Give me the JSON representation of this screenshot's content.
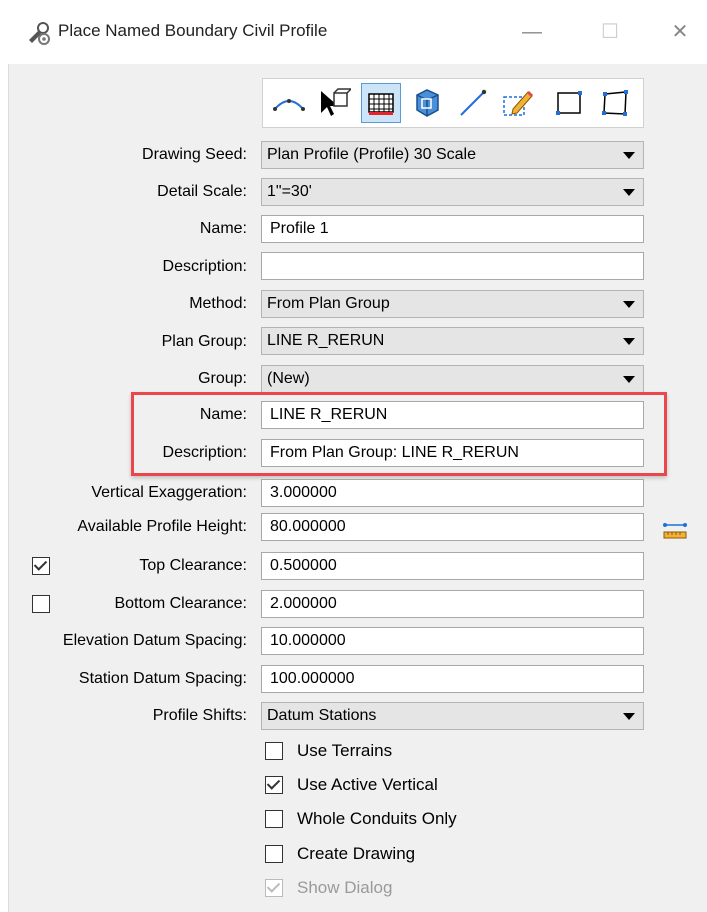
{
  "window": {
    "title": "Place Named Boundary Civil Profile",
    "minimize_glyph": "—",
    "maximize_glyph": "☐",
    "close_glyph": "✕"
  },
  "toolbar": {
    "tools": [
      {
        "icon": "civil-profile-icon",
        "active": false
      },
      {
        "icon": "select-element-icon",
        "active": false
      },
      {
        "icon": "grid-table-icon",
        "active": true
      },
      {
        "icon": "3d-box-icon",
        "active": false
      },
      {
        "icon": "line-icon",
        "active": false
      },
      {
        "icon": "pencil-edit-icon",
        "active": false
      },
      {
        "icon": "rectangle-icon",
        "active": false
      },
      {
        "icon": "shape-icon",
        "active": false
      }
    ]
  },
  "form": {
    "drawing_seed": {
      "label": "Drawing Seed:",
      "value": "Plan Profile (Profile) 30 Scale"
    },
    "detail_scale": {
      "label": "Detail Scale:",
      "value": "1\"=30'"
    },
    "name": {
      "label": "Name:",
      "value": "Profile 1"
    },
    "description": {
      "label": "Description:",
      "value": ""
    },
    "method": {
      "label": "Method:",
      "value": "From Plan Group"
    },
    "plan_group": {
      "label": "Plan Group:",
      "value": "LINE R_RERUN"
    },
    "group": {
      "label": "Group:",
      "value": "(New)"
    },
    "group_name": {
      "label": "Name:",
      "value": "LINE R_RERUN"
    },
    "group_description": {
      "label": "Description:",
      "value": "From Plan Group: LINE R_RERUN"
    },
    "vertical_exaggeration": {
      "label": "Vertical Exaggeration:",
      "value": "3.000000"
    },
    "available_profile_height": {
      "label": "Available Profile Height:",
      "value": "80.000000"
    },
    "top_clearance": {
      "label": "Top Clearance:",
      "value": "0.500000",
      "checked": true
    },
    "bottom_clearance": {
      "label": "Bottom Clearance:",
      "value": "2.000000",
      "checked": false
    },
    "elevation_datum_spacing": {
      "label": "Elevation Datum Spacing:",
      "value": "10.000000"
    },
    "station_datum_spacing": {
      "label": "Station Datum Spacing:",
      "value": "100.000000"
    },
    "profile_shifts": {
      "label": "Profile Shifts:",
      "value": "Datum Stations"
    }
  },
  "options": {
    "use_terrains": {
      "label": "Use Terrains",
      "checked": false
    },
    "use_active_vertical": {
      "label": "Use Active Vertical",
      "checked": true
    },
    "whole_conduits_only": {
      "label": "Whole Conduits Only",
      "checked": false
    },
    "create_drawing": {
      "label": "Create Drawing",
      "checked": false
    },
    "show_dialog": {
      "label": "Show Dialog",
      "checked": true,
      "disabled": true
    }
  },
  "colors": {
    "highlight_border": "#e8474c",
    "active_tool_bg": "#cce4f7",
    "accent_blue": "#1e6fd9"
  }
}
